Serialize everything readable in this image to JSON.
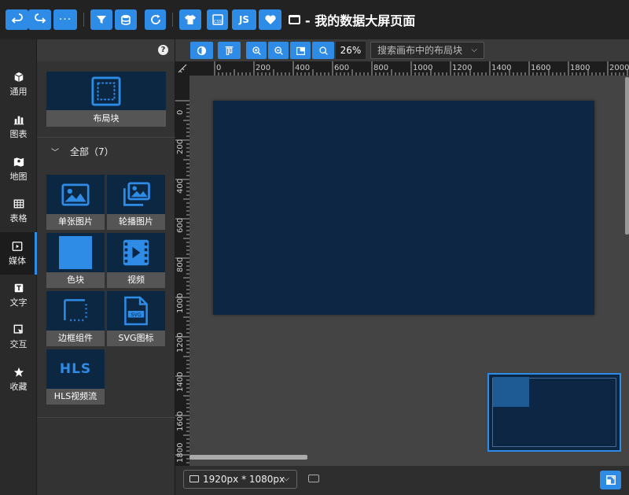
{
  "title": "- 我的数据大屏页面",
  "sidebar": {
    "items": [
      {
        "label": "通用",
        "icon": "cube-icon"
      },
      {
        "label": "图表",
        "icon": "bar-chart-icon"
      },
      {
        "label": "地图",
        "icon": "map-icon"
      },
      {
        "label": "表格",
        "icon": "table-icon"
      },
      {
        "label": "媒体",
        "icon": "media-icon",
        "active": true
      },
      {
        "label": "文字",
        "icon": "text-icon"
      },
      {
        "label": "交互",
        "icon": "interact-icon"
      },
      {
        "label": "收藏",
        "icon": "star-icon"
      }
    ]
  },
  "panel": {
    "layout_block_label": "布局块",
    "group_label": "全部（7）",
    "cards": [
      {
        "label": "单张图片",
        "icon": "image-icon"
      },
      {
        "label": "轮播图片",
        "icon": "images-icon"
      },
      {
        "label": "色块",
        "icon": "color-block-icon"
      },
      {
        "label": "视频",
        "icon": "video-icon"
      },
      {
        "label": "边框组件",
        "icon": "border-icon"
      },
      {
        "label": "SVG图标",
        "icon": "svg-file-icon"
      },
      {
        "label": "HLS视频流",
        "icon": "hls-icon"
      }
    ],
    "svg_badge": "SVG",
    "hls_badge": "HLS"
  },
  "toolbar": {
    "js_label": "JS",
    "zoom_value": "26%",
    "search_placeholder": "搜索画布中的布局块"
  },
  "ruler": {
    "top_ticks": [
      "0",
      "200",
      "400",
      "600",
      "800",
      "1000",
      "1200",
      "1400",
      "1600",
      "1800",
      "2000"
    ],
    "left_ticks": [
      "0",
      "200",
      "400",
      "600",
      "800",
      "1000",
      "1200",
      "1400",
      "1600",
      "1800"
    ]
  },
  "bottom": {
    "size_label": "1920px * 1080px"
  },
  "colors": {
    "accent": "#2e8be6",
    "canvas": "#0c2643"
  }
}
